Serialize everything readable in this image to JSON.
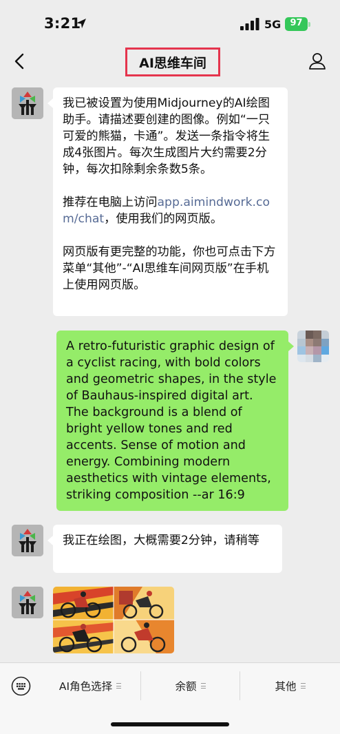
{
  "status_bar": {
    "time": "3:21",
    "network": "5G",
    "battery": "97"
  },
  "nav": {
    "title": "AI思维车间"
  },
  "messages": {
    "bot_intro": {
      "p1": "我已被设置为使用Midjourney的AI绘图助手。请描述要创建的图像。例如“一只可爱的熊猫，卡通”。发送一条指令将生成4张图片。每次生成图片大约需要2分钟，每次扣除剩余条数5条。",
      "p2_prefix": "推荐在电脑上访问",
      "p2_link": "app.aimindwork.com/chat",
      "p2_suffix": "，使用我们的网页版。",
      "p3": "网页版有更完整的功能，你也可点击下方菜单“其他”-“AI思维车间网页版”在手机上使用网页版。"
    },
    "user_prompt": "A retro-futuristic graphic design of a cyclist racing, with bold colors and geometric shapes, in the style of Bauhaus-inspired digital art. The background is a blend of bright yellow tones and red accents. Sense of motion and energy. Combining modern aesthetics with vintage elements, striking composition --ar 16:9",
    "bot_wait": "我正在绘图，大概需要2分钟，请稍等"
  },
  "menu": {
    "item1": "AI角色选择",
    "item2": "余额",
    "item3": "其他"
  },
  "colors": {
    "bot_bubble": "#ffffff",
    "user_bubble": "#95ec69",
    "link": "#576b95",
    "title_highlight": "#e5344d",
    "background": "#ededed"
  },
  "icons": [
    "location-arrow-icon",
    "signal-icon",
    "battery-icon",
    "back-chevron-icon",
    "person-icon",
    "keyboard-icon"
  ]
}
